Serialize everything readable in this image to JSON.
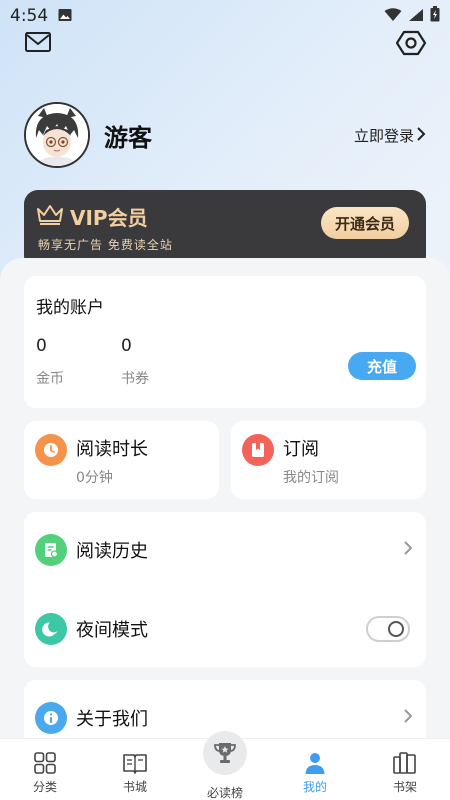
{
  "status_bar": {
    "time": "4:54"
  },
  "profile": {
    "name": "游客",
    "login_text": "立即登录"
  },
  "vip": {
    "title": "VIP会员",
    "subtitle": "畅享无广告 免费读全站",
    "button": "开通会员"
  },
  "account": {
    "title": "我的账户",
    "coins_value": "0",
    "coins_label": "金币",
    "tickets_value": "0",
    "tickets_label": "书券",
    "recharge": "充值"
  },
  "reading_time": {
    "title": "阅读时长",
    "value": "0分钟"
  },
  "subscription": {
    "title": "订阅",
    "subtitle": "我的订阅"
  },
  "menu": {
    "history": "阅读历史",
    "night_mode": "夜间模式",
    "night_mode_on": false,
    "about": "关于我们"
  },
  "nav": {
    "items": [
      {
        "label": "分类",
        "icon": "grid-icon"
      },
      {
        "label": "书城",
        "icon": "open-book-icon"
      },
      {
        "label": "必读榜",
        "icon": "trophy-icon"
      },
      {
        "label": "我的",
        "icon": "person-icon",
        "active": true
      },
      {
        "label": "书架",
        "icon": "bookshelf-icon"
      }
    ]
  },
  "colors": {
    "accent": "#48a9f3",
    "vip_bg": "#3a3a3c",
    "vip_gold": "#f3cfa0",
    "reading_icon": "#f5934d",
    "subscribe_icon": "#f2645a",
    "history_icon": "#52d07c",
    "night_icon": "#3cc8a4",
    "about_icon": "#49a8ee"
  }
}
